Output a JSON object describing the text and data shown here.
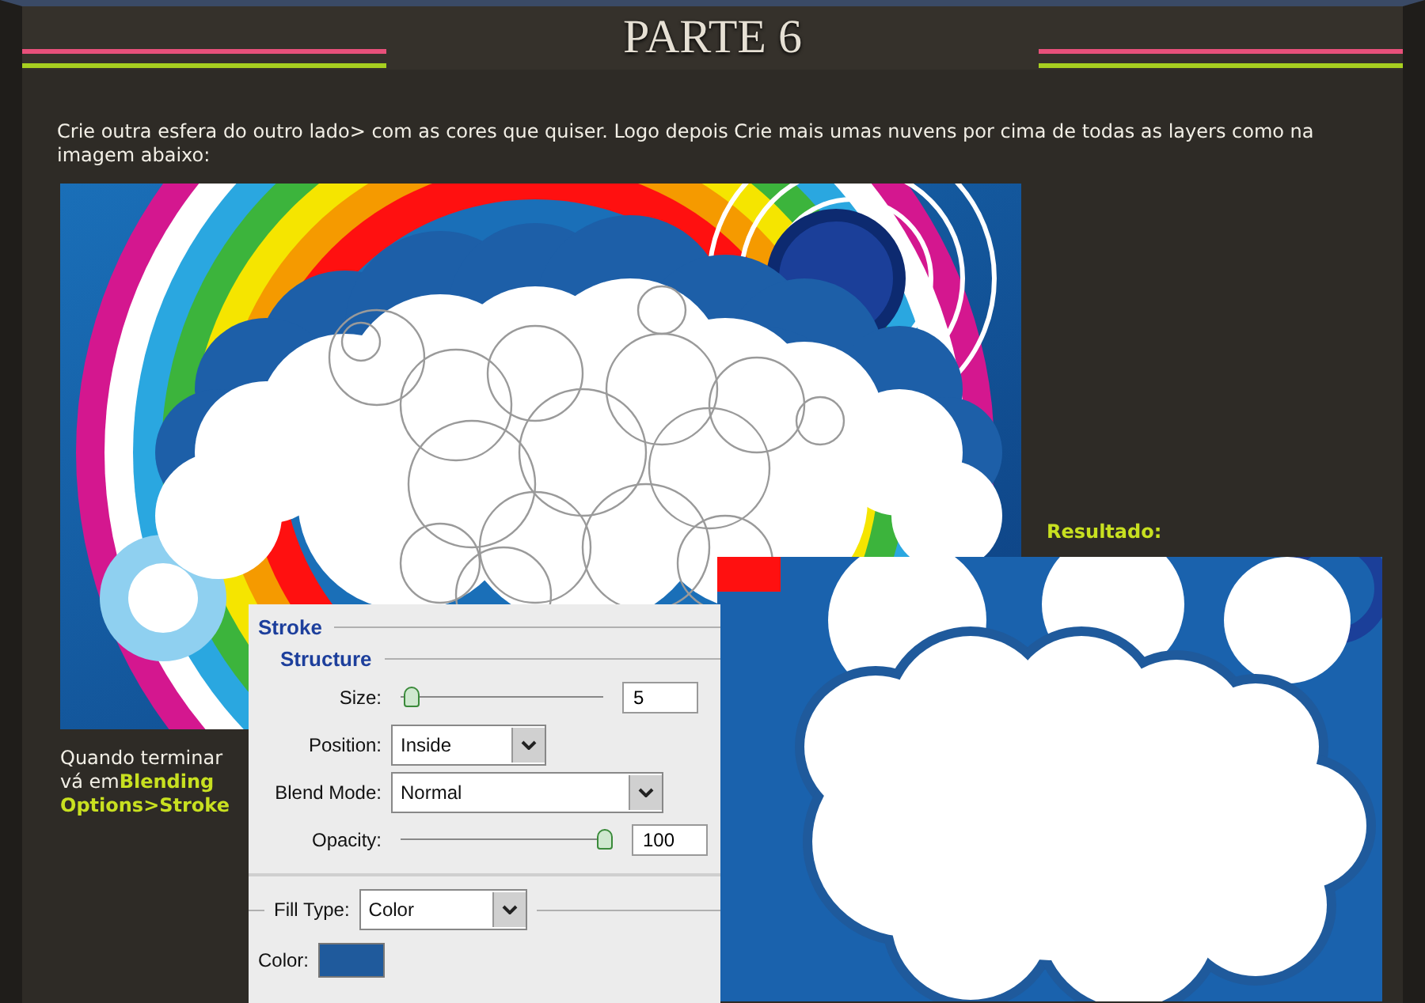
{
  "header": {
    "title": "PARTE 6"
  },
  "intro": "Crie outra esfera do outro lado> com as cores que quiser. Logo depois Crie mais umas nuvens por cima de todas as layers como na imagem abaixo:",
  "side_note": "Quando terminar vá em**Blending Options>Stroke**",
  "result_label": "Resultado:",
  "dialog": {
    "title": "Stroke",
    "section": "Structure",
    "size": {
      "label": "Size:",
      "value": "5",
      "level": 0.02
    },
    "position": {
      "label": "Position:",
      "value": "Inside"
    },
    "blend_mode": {
      "label": "Blend Mode:",
      "value": "Normal"
    },
    "opacity": {
      "label": "Opacity:",
      "value": "100",
      "level": 1
    },
    "fill_type": {
      "label": "Fill Type:",
      "value": "Color"
    },
    "color": {
      "label": "Color:",
      "color": "#1f5a9c"
    }
  }
}
